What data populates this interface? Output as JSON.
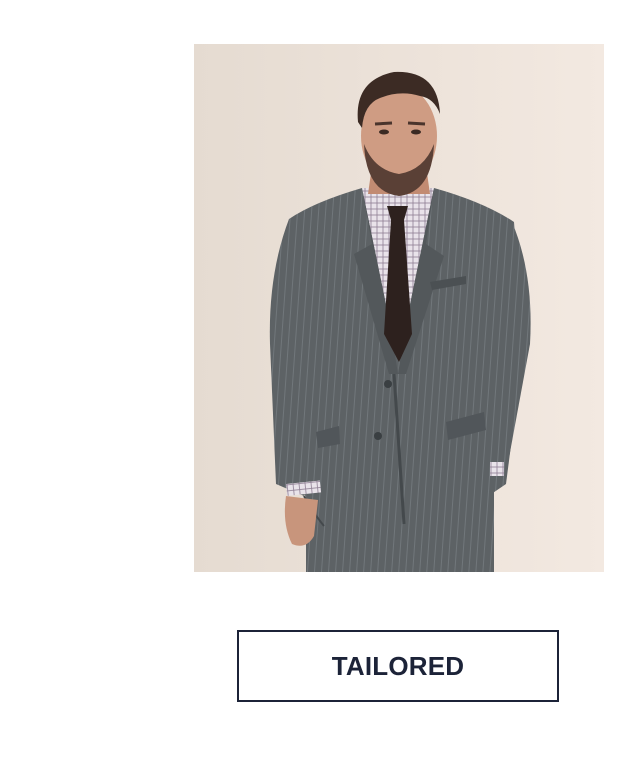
{
  "hero": {
    "image_subject": "man-in-grey-pinstripe-suit",
    "background_color": "#eee3da"
  },
  "cta": {
    "label": "TAILORED",
    "text_color": "#1c2338",
    "border_color": "#1c2338"
  }
}
